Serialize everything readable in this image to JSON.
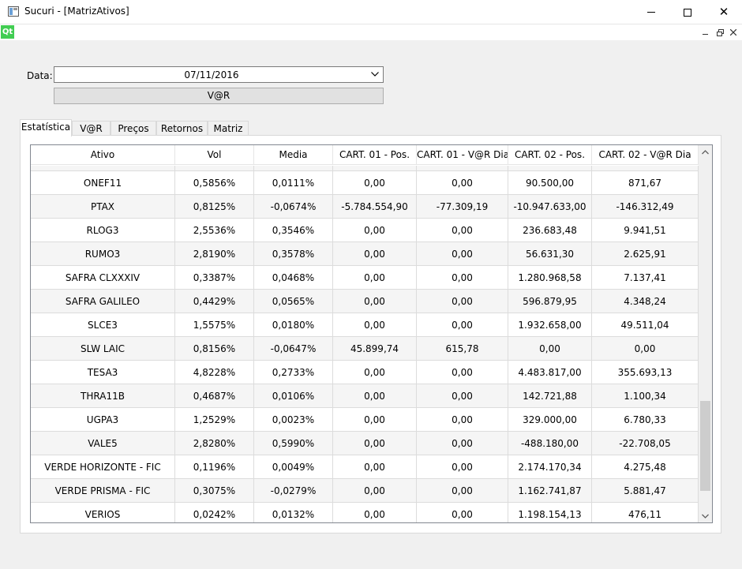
{
  "window": {
    "title": "Sucuri - [MatrizAtivos]"
  },
  "mdi": {
    "logo": "Qt"
  },
  "form": {
    "date_label": "Data:",
    "date_value": "07/11/2016",
    "var_button": "V@R"
  },
  "tabs": [
    {
      "label": "Estatística",
      "active": true
    },
    {
      "label": "V@R",
      "active": false
    },
    {
      "label": "Preços",
      "active": false
    },
    {
      "label": "Retornos",
      "active": false
    },
    {
      "label": "Matriz",
      "active": false
    }
  ],
  "table": {
    "headers": [
      "Ativo",
      "Vol",
      "Media",
      "CART. 01 - Pos.",
      "CART. 01 - V@R Dia",
      "CART. 02 - Pos.",
      "CART. 02 - V@R Dia"
    ],
    "rows": [
      [
        "",
        "",
        "",
        "",
        "",
        "",
        ""
      ],
      [
        "ONEF11",
        "0,5856%",
        "0,0111%",
        "0,00",
        "0,00",
        "90.500,00",
        "871,67"
      ],
      [
        "PTAX",
        "0,8125%",
        "-0,0674%",
        "-5.784.554,90",
        "-77.309,19",
        "-10.947.633,00",
        "-146.312,49"
      ],
      [
        "RLOG3",
        "2,5536%",
        "0,3546%",
        "0,00",
        "0,00",
        "236.683,48",
        "9.941,51"
      ],
      [
        "RUMO3",
        "2,8190%",
        "0,3578%",
        "0,00",
        "0,00",
        "56.631,30",
        "2.625,91"
      ],
      [
        "SAFRA CLXXXIV",
        "0,3387%",
        "0,0468%",
        "0,00",
        "0,00",
        "1.280.968,58",
        "7.137,41"
      ],
      [
        "SAFRA GALILEO",
        "0,4429%",
        "0,0565%",
        "0,00",
        "0,00",
        "596.879,95",
        "4.348,24"
      ],
      [
        "SLCE3",
        "1,5575%",
        "0,0180%",
        "0,00",
        "0,00",
        "1.932.658,00",
        "49.511,04"
      ],
      [
        "SLW LAIC",
        "0,8156%",
        "-0,0647%",
        "45.899,74",
        "615,78",
        "0,00",
        "0,00"
      ],
      [
        "TESA3",
        "4,8228%",
        "0,2733%",
        "0,00",
        "0,00",
        "4.483.817,00",
        "355.693,13"
      ],
      [
        "THRA11B",
        "0,4687%",
        "0,0106%",
        "0,00",
        "0,00",
        "142.721,88",
        "1.100,34"
      ],
      [
        "UGPA3",
        "1,2529%",
        "0,0023%",
        "0,00",
        "0,00",
        "329.000,00",
        "6.780,33"
      ],
      [
        "VALE5",
        "2,8280%",
        "0,5990%",
        "0,00",
        "0,00",
        "-488.180,00",
        "-22.708,05"
      ],
      [
        "VERDE HORIZONTE - FIC",
        "0,1196%",
        "0,0049%",
        "0,00",
        "0,00",
        "2.174.170,34",
        "4.275,48"
      ],
      [
        "VERDE PRISMA - FIC",
        "0,3075%",
        "-0,0279%",
        "0,00",
        "0,00",
        "1.162.741,87",
        "5.881,47"
      ],
      [
        "VERIOS",
        "0,0242%",
        "0,0132%",
        "0,00",
        "0,00",
        "1.198.154,13",
        "476,11"
      ]
    ],
    "scroll_position": 0.93
  },
  "colors": {
    "qt_green": "#41cd52",
    "alt_row": "#f5f5f5",
    "button_face": "#e1e1e1"
  }
}
